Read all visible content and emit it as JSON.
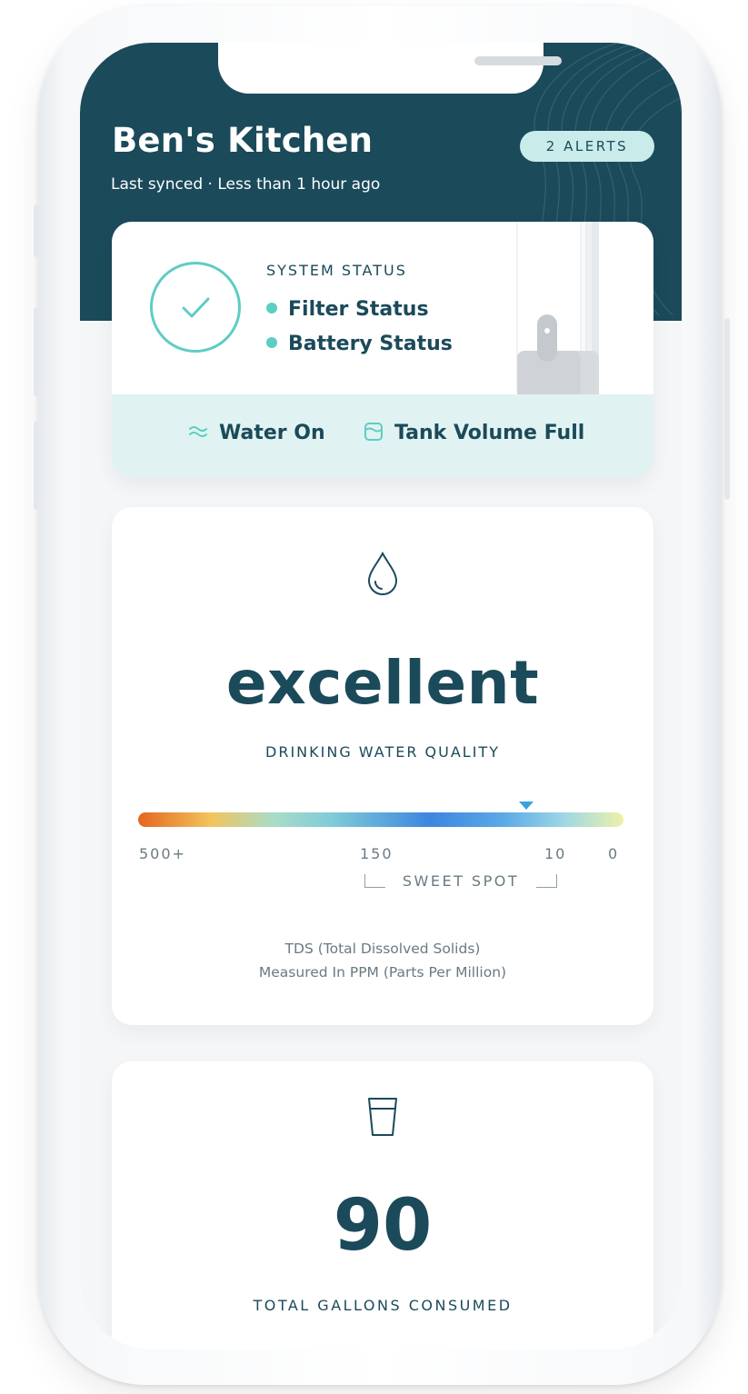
{
  "header": {
    "title": "Ben's Kitchen",
    "synced": "Last synced · Less than 1 hour ago",
    "alerts_badge": "2 ALERTS"
  },
  "system_status": {
    "label": "SYSTEM STATUS",
    "items": [
      "Filter Status",
      "Battery Status"
    ],
    "status_icon": "check-icon",
    "strip": [
      {
        "label": "Water On",
        "icon": "water-waves-icon"
      },
      {
        "label": "Tank Volume Full",
        "icon": "tank-icon"
      }
    ]
  },
  "water_quality": {
    "icon": "water-drop-icon",
    "rating": "excellent",
    "label": "DRINKING WATER QUALITY",
    "scale_ticks": [
      "500+",
      "150",
      "10",
      "0"
    ],
    "sweet_spot_label": "SWEET SPOT",
    "marker_position_fraction": 0.8,
    "note_line1": "TDS (Total Dissolved Solids)",
    "note_line2": "Measured In PPM (Parts Per Million)"
  },
  "consumption": {
    "icon": "glass-icon",
    "value": "90",
    "label": "TOTAL GALLONS CONSUMED"
  },
  "colors": {
    "primary": "#1b4a5a",
    "accent": "#5ecdc4",
    "strip_bg": "#e0f3f2",
    "badge_bg": "#c9ecea"
  }
}
